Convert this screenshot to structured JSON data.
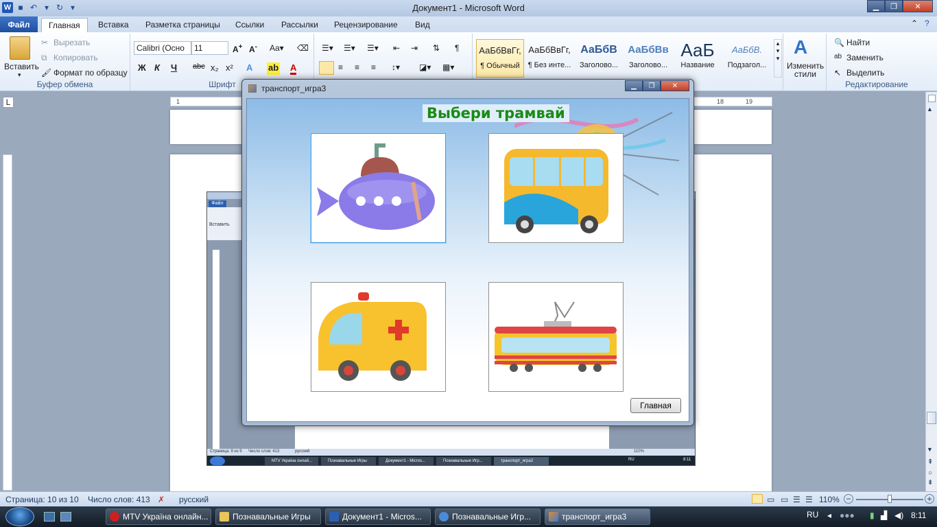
{
  "window": {
    "title": "Документ1  -  Microsoft Word"
  },
  "tabs": [
    "Файл",
    "Главная",
    "Вставка",
    "Разметка страницы",
    "Ссылки",
    "Рассылки",
    "Рецензирование",
    "Вид"
  ],
  "clipboard": {
    "paste": "Вставить",
    "cut": "Вырезать",
    "copy": "Копировать",
    "format_painter": "Формат по образцу",
    "label": "Буфер обмена"
  },
  "font": {
    "name": "Calibri (Осно",
    "size": "11",
    "label": "Шрифт",
    "bold": "Ж",
    "italic": "К",
    "underline": "Ч",
    "strike": "abc"
  },
  "styles": [
    {
      "preview": "АаБбВвГг,",
      "name": "¶ Обычный"
    },
    {
      "preview": "АаБбВвГг,",
      "name": "¶ Без инте..."
    },
    {
      "preview": "АаБбВ",
      "name": "Заголово..."
    },
    {
      "preview": "АаБбВв",
      "name": "Заголово..."
    },
    {
      "preview": "АаБ",
      "name": "Название"
    },
    {
      "preview": "АаБбВ.",
      "name": "Подзагол..."
    }
  ],
  "change_styles": "Изменить стили",
  "editing": {
    "find": "Найти",
    "replace": "Заменить",
    "select": "Выделить",
    "label": "Редактирование"
  },
  "ruler": {
    "marks": [
      "1",
      "18",
      "19"
    ]
  },
  "status": {
    "page": "Страница: 10 из 10",
    "words": "Число слов: 413",
    "lang": "русский",
    "zoom": "110%"
  },
  "dialog": {
    "title": "транспорт_игра3",
    "heading": "Выбери трамвай",
    "home_button": "Главная",
    "cards": [
      "submarine",
      "bus",
      "ambulance",
      "tram"
    ]
  },
  "thumb": {
    "file_tab": "Файл",
    "paste": "Вставить",
    "status_page": "Страница: 9 из 9",
    "status_words": "Число слов: 413",
    "status_lang": "русский",
    "zoom": "110%",
    "tasks": [
      "MTV Україна онлай...",
      "Познавальные Игры",
      "Документ1 - Micros...",
      "Познавальные Игр...",
      "транспорт_игра2"
    ],
    "clock": "8:11",
    "lang": "RU"
  },
  "taskbar": {
    "items": [
      "MTV Україна онлайн...",
      "Познавальные Игры",
      "Документ1 - Micros...",
      "Познавальные Игр...",
      "транспорт_игра3"
    ],
    "lang": "RU",
    "clock": "8:11"
  }
}
